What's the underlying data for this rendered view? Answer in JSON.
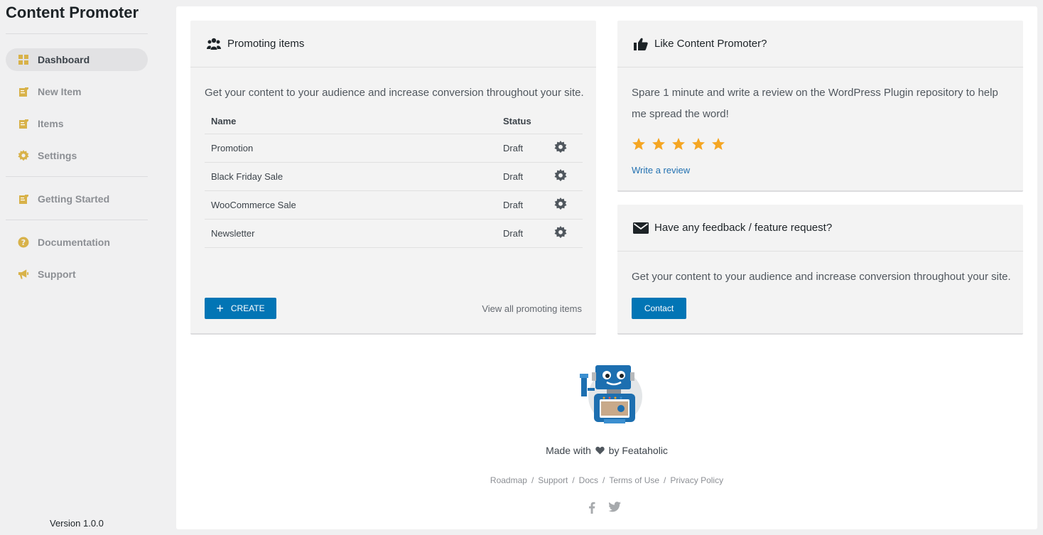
{
  "app": {
    "title": "Content Promoter",
    "version": "Version 1.0.0"
  },
  "sidebar": {
    "items": [
      {
        "label": "Dashboard",
        "icon": "dashboard-icon",
        "active": true
      },
      {
        "label": "New Item",
        "icon": "edit-icon"
      },
      {
        "label": "Items",
        "icon": "edit-icon"
      },
      {
        "label": "Settings",
        "icon": "gear-icon"
      },
      {
        "label": "Getting Started",
        "icon": "edit-icon"
      },
      {
        "label": "Documentation",
        "icon": "help-icon"
      },
      {
        "label": "Support",
        "icon": "megaphone-icon"
      }
    ]
  },
  "promoting": {
    "title": "Promoting items",
    "description": "Get your content to your audience and increase conversion throughout your site.",
    "columns": {
      "name": "Name",
      "status": "Status"
    },
    "rows": [
      {
        "name": "Promotion",
        "status": "Draft"
      },
      {
        "name": "Black Friday Sale",
        "status": "Draft"
      },
      {
        "name": "WooCommerce Sale",
        "status": "Draft"
      },
      {
        "name": "Newsletter",
        "status": "Draft"
      }
    ],
    "create_label": "CREATE",
    "view_all_label": "View all promoting items"
  },
  "like": {
    "title": "Like Content Promoter?",
    "text": "Spare 1 minute and write a review on the WordPress Plugin repository to help me spread the word!",
    "rating": 5,
    "review_link": "Write a review"
  },
  "feedback": {
    "title": "Have any feedback / feature request?",
    "text": "Get your content to your audience and increase conversion throughout your site.",
    "contact_label": "Contact"
  },
  "footer": {
    "made_prefix": "Made with",
    "made_suffix": "by Feataholic",
    "links": [
      "Roadmap",
      "Support",
      "Docs",
      "Terms of Use",
      "Privacy Policy"
    ],
    "social": [
      "facebook-icon",
      "twitter-icon"
    ]
  },
  "colors": {
    "accent": "#0275b5",
    "icon_gold": "#d8b24a",
    "star": "#f5a623"
  }
}
